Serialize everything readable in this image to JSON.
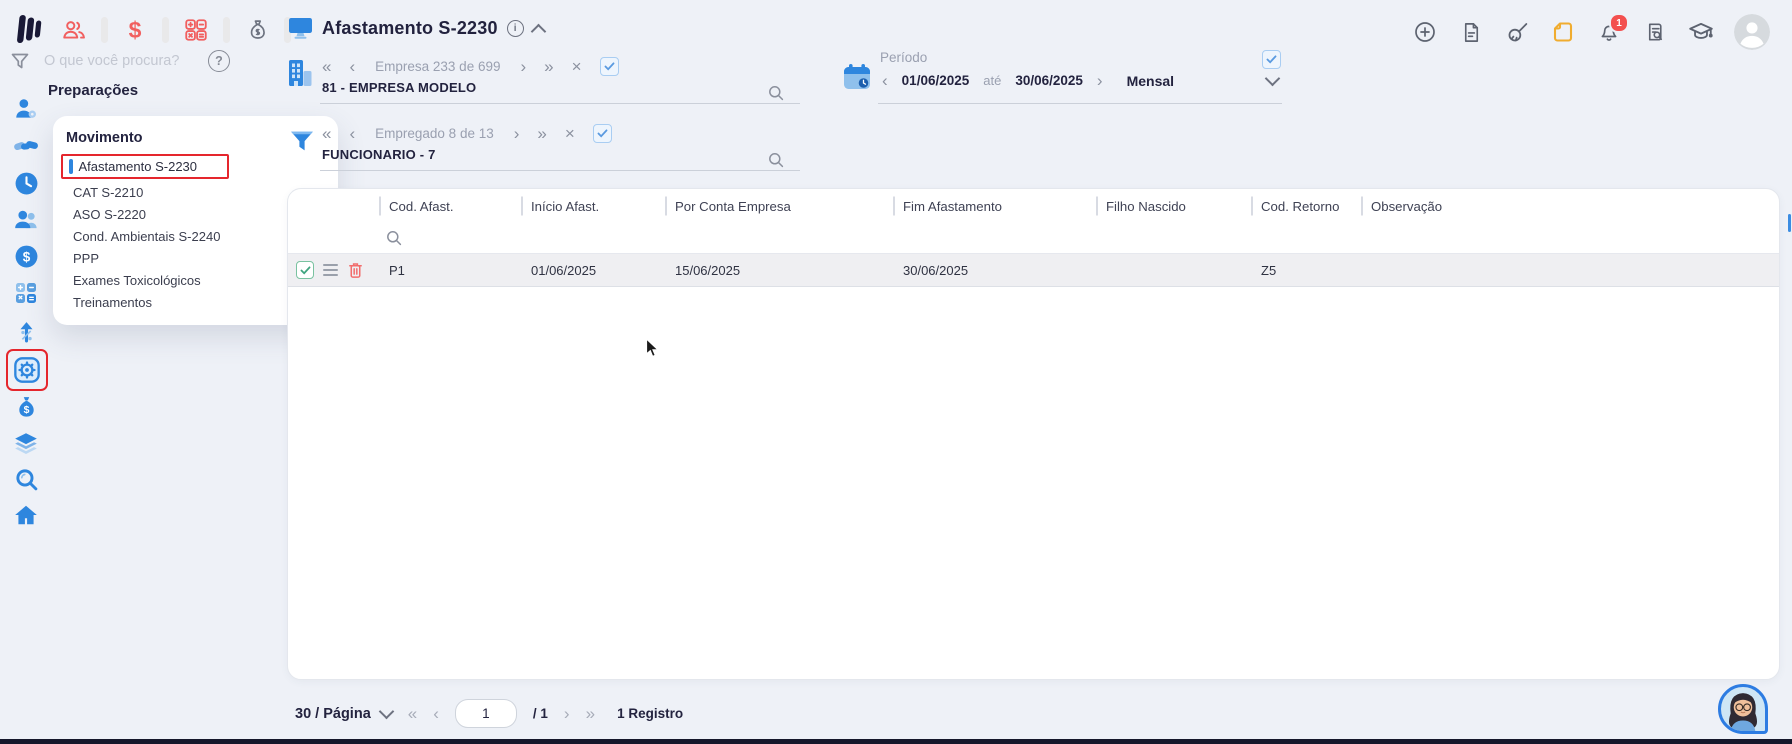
{
  "topbar": {
    "search_placeholder": "O que você procura?",
    "help_glyph": "?",
    "notifications_badge": "1"
  },
  "sidebar": {
    "section_title": "Preparações"
  },
  "menu": {
    "title": "Movimento",
    "items": [
      {
        "label": "Afastamento S-2230",
        "selected": true
      },
      {
        "label": "CAT S-2210"
      },
      {
        "label": "ASO S-2220"
      },
      {
        "label": "Cond. Ambientais S-2240"
      },
      {
        "label": "PPP"
      },
      {
        "label": "Exames Toxicológicos"
      },
      {
        "label": "Treinamentos"
      }
    ]
  },
  "header": {
    "title": "Afastamento S-2230"
  },
  "company_nav": {
    "first": "«",
    "prev": "‹",
    "counter": "Empresa 233 de 699",
    "next": "›",
    "last": "»",
    "clear": "×",
    "value": "81 - EMPRESA MODELO"
  },
  "employee_nav": {
    "first": "«",
    "prev": "‹",
    "counter": "Empregado 8 de 13",
    "next": "›",
    "last": "»",
    "clear": "×",
    "value": "FUNCIONARIO - 7"
  },
  "period": {
    "label": "Período",
    "prev": "‹",
    "start_date": "01/06/2025",
    "until": "até",
    "end_date": "30/06/2025",
    "next": "›",
    "mode": "Mensal"
  },
  "table": {
    "columns": [
      "Cod. Afast.",
      "Início Afast.",
      "Por Conta Empresa",
      "Fim Afastamento",
      "Filho Nascido",
      "Cod. Retorno",
      "Observação"
    ],
    "rows": [
      [
        "P1",
        "01/06/2025",
        "15/06/2025",
        "30/06/2025",
        "",
        "Z5",
        ""
      ]
    ]
  },
  "pagination": {
    "per_page": "30 / Página",
    "first": "«",
    "prev": "‹",
    "current_page": "1",
    "of_pages": "/ 1",
    "next": "›",
    "last": "»",
    "total": "1 Registro"
  },
  "icons": {
    "logo": "three-bars-mark",
    "modules": [
      "people-icon",
      "dollar-icon",
      "calculator-icon",
      "money-bag-icon"
    ],
    "rail": [
      "person-config-icon",
      "handshake-icon",
      "clock-icon",
      "people-icon",
      "dollar-circle-icon",
      "calculator-icon",
      "growth-icon",
      "esocial-gear-icon",
      "money-bag-icon",
      "layers-icon",
      "search-icon",
      "home-icon"
    ],
    "top_right": [
      "plus-circle-icon",
      "document-icon",
      "broom-icon",
      "note-icon",
      "bell-icon",
      "document-search-icon",
      "graduation-cap-icon",
      "avatar"
    ]
  },
  "colors": {
    "accent_blue": "#2e86de",
    "accent_red": "#f15f5f",
    "selection_red": "#e5262d",
    "dark_navy": "#23233f",
    "note_yellow": "#f0ac2f",
    "row_gray": "#efeff2"
  }
}
